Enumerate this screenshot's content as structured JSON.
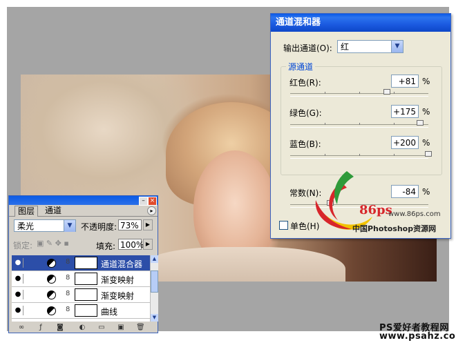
{
  "mixer": {
    "title": "通道混和器",
    "output_label": "输出通道(O):",
    "output_value": "红",
    "source_group": "源通道",
    "channels": [
      {
        "label": "红色(R):",
        "value": "+81",
        "pct": "%",
        "level": 0.702
      },
      {
        "label": "绿色(G):",
        "value": "+175",
        "pct": "%",
        "level": 0.94
      },
      {
        "label": "蓝色(B):",
        "value": "+200",
        "pct": "%",
        "level": 1.0
      }
    ],
    "constant_label": "常数(N):",
    "constant_value": "-84",
    "constant_pct": "%",
    "constant_level": 0.29,
    "mono_label": "单色(H)"
  },
  "logo": {
    "brand": "86ps",
    "url": "www.86ps.com",
    "caption": "中国Photoshop资源网"
  },
  "layers": {
    "tabs": [
      "图层",
      "通道"
    ],
    "blend_mode": "柔光",
    "opacity_label": "不透明度:",
    "opacity_value": "73%",
    "lock_label": "锁定:",
    "fill_label": "填充:",
    "fill_value": "100%",
    "rows": [
      {
        "name": "通道混合器",
        "selected": true
      },
      {
        "name": "渐变映射",
        "selected": false
      },
      {
        "name": "渐变映射",
        "selected": false
      },
      {
        "name": "曲线",
        "selected": false
      }
    ]
  },
  "watermark": {
    "line1": "PS爱好者教程网",
    "line2": "www.psahz.com"
  },
  "colors": {
    "titlebar": "#0a59e6",
    "dialog_bg": "#ece9d8",
    "selected_row": "#2c4ea8",
    "logo_red": "#d7262b",
    "logo_green": "#2f9a3a",
    "logo_yellow": "#f2c200"
  }
}
